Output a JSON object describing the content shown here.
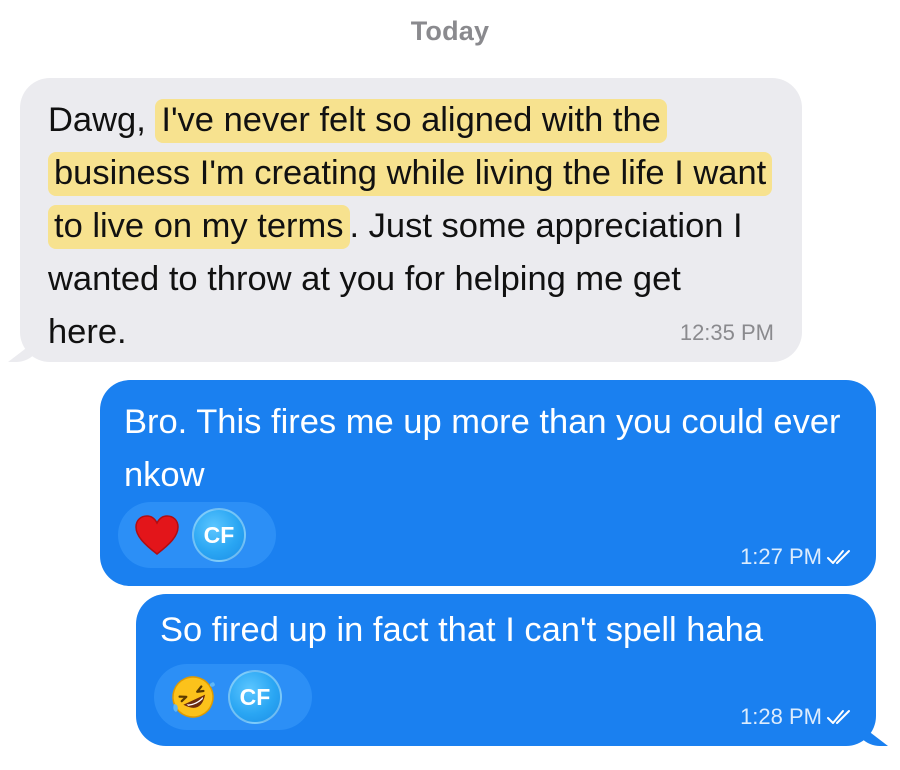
{
  "date_header": "Today",
  "messages": [
    {
      "direction": "incoming",
      "text_before": "Dawg, ",
      "text_highlight": "I've never felt so aligned with the business I'm creating while living the life I want to live on my terms",
      "text_after": ". Just some appreciation I wanted to throw at you for helping me get here.",
      "highlight_color": "#f7e28f",
      "time": "12:35 PM"
    },
    {
      "direction": "outgoing",
      "text": "Bro. This fires me up more than you could ever nkow",
      "reaction_icon": "heart-icon",
      "reactor_initials": "CF",
      "time": "1:27 PM",
      "status_icon": "double-check-icon"
    },
    {
      "direction": "outgoing",
      "text": "So fired up in fact that I can't spell haha",
      "reaction_icon": "rolling-laughing-icon",
      "reactor_initials": "CF",
      "time": "1:28 PM",
      "status_icon": "double-check-icon"
    }
  ],
  "colors": {
    "incoming_bubble": "#ebebef",
    "outgoing_bubble": "#1a80f0",
    "reaction_pill": "#2c8ff6",
    "timestamp_gray": "#8a8a8e"
  }
}
